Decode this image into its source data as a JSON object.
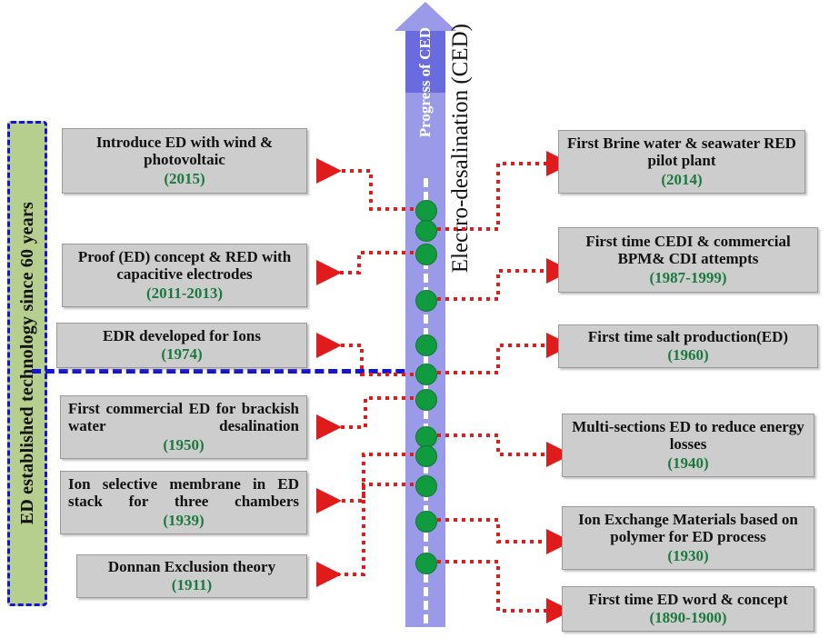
{
  "colors": {
    "box_fill": "#cdcdcd",
    "box_border": "#9a9a9a",
    "year_green": "#1a7a3e",
    "dot_green": "#0f9b3e",
    "arrow_purple_light": "#9a9ae8",
    "arrow_purple_dark": "#6b6be0",
    "dashed_blue": "#1414d2",
    "label_green": "#b6ce8e",
    "connector_red": "#e01b1b"
  },
  "side_label": {
    "vertical_left": "ED established technology since 60 years",
    "arrow_text": "Progress of CED",
    "process_name": "Electro-desalination (CED)"
  },
  "timeline": {
    "dot_count": 11,
    "icons": {
      "arrow_up": "up-arrow-icon",
      "dot": "timeline-dot-icon",
      "connector": "connector-arrow-icon"
    }
  },
  "events_left": [
    {
      "id": "ev-2015",
      "title": "Introduce ED with wind & photovoltaic",
      "year": "(2015)"
    },
    {
      "id": "ev-2011",
      "title": "Proof (ED) concept & RED with capacitive electrodes",
      "year": "(2011-2013)"
    },
    {
      "id": "ev-1974",
      "title": "EDR developed for Ions",
      "year": "(1974)"
    },
    {
      "id": "ev-1950",
      "title": "First commercial ED for brackish water desalination",
      "year": "(1950)"
    },
    {
      "id": "ev-1939",
      "title": "Ion selective membrane in ED stack for three chambers",
      "year": "(1939)"
    },
    {
      "id": "ev-1911",
      "title": "Donnan Exclusion theory",
      "year": "(1911)"
    }
  ],
  "events_right": [
    {
      "id": "ev-2014",
      "title": "First Brine water & seawater RED pilot plant",
      "year": "(2014)"
    },
    {
      "id": "ev-1987",
      "title": "First time CEDI & commercial BPM& CDI attempts",
      "year": "(1987-1999)"
    },
    {
      "id": "ev-1960",
      "title": "First time salt production(ED)",
      "year": "(1960)"
    },
    {
      "id": "ev-1940",
      "title": "Multi-sections ED to reduce energy losses",
      "year": "(1940)"
    },
    {
      "id": "ev-1930",
      "title": "Ion Exchange Materials based on polymer for ED process",
      "year": "(1930)"
    },
    {
      "id": "ev-1890",
      "title": "First time ED word & concept",
      "year": "(1890-1900)"
    }
  ]
}
